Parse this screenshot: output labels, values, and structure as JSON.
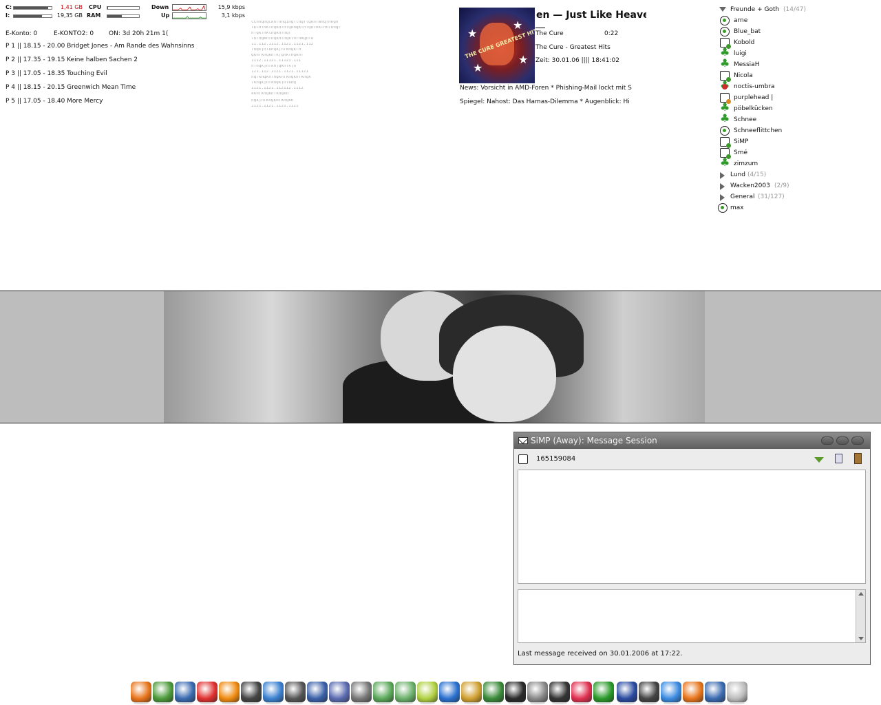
{
  "sysmon": {
    "drive_c_label": "C:",
    "drive_c_value": "1,41 GB",
    "drive_c_fill": 0.9,
    "drive_i_label": "I:",
    "drive_i_value": "19,35 GB",
    "drive_i_fill": 0.75,
    "cpu_label": "CPU",
    "cpu_fill": 0.02,
    "ram_label": "RAM",
    "ram_fill": 0.45,
    "down_label": "Down",
    "down_value": "15,9 kbps",
    "up_label": "Up",
    "up_value": "3,1 kbps",
    "down_color": "#cc2222",
    "up_color": "#2a9a2a"
  },
  "info": {
    "ekonto": "E-Konto:  0",
    "ekonto2": "E-KONTO2:  0",
    "online": "ON:  3d 20h 21m 1("
  },
  "tv": [
    {
      "text": "P 1 || 18.15 - 20.00  Bridget Jones - Am Rande des Wahnsinns"
    },
    {
      "text": "P 2 || 17.35 - 19.15  Keine halben Sachen 2"
    },
    {
      "text": "P 3 || 17.05 - 18.35  Touching Evil"
    },
    {
      "text": "P 4 || 18.15 - 20.15  Greenwich Mean Time"
    },
    {
      "text": "P 5 || 17.05 - 18.40  More Mercy"
    }
  ],
  "noise_lines": [
    "cchhghgckhfhhgihgflhgflgkhfmhgfhkgh",
    "lklhfhkfhgkhfhfgkhgkfhfgklhkfhhfkhgf",
    "hfgkfhklhgkhfhgf",
    "lhfhgkhfhgkhfhgklhfhkghfk",
    "11.112.1112.1121.1121.112",
    "fhgkjhfkhgkjhfkhgkfh",
    "gkhfkhgkhfkjghkfhgkhf",
    "1112.11121.11121.111",
    "hfhgkjhfkhjgkhfkjh",
    "121.112.1121.1121.11121",
    "hgfkhgkhfhgkhfkhgkhfkhgk",
    "fkhgkjhfkhgkjhfkhg",
    "1121.1121.112112.1112",
    "kkhfkhgkhfkhgkh",
    "hgkjhfkhgkhfkhgkh",
    "1121.1121.1121.1121"
  ],
  "now_playing": {
    "title": "en  —  Just Like Heaven",
    "artist": "The Cure",
    "time": "0:22",
    "album": "The Cure - Greatest Hits",
    "datetime": "Zeit: 30.01.06 |||| 18:41:02",
    "cover_text": "THE CURE  GREATEST HITS"
  },
  "news": {
    "line1": "News: Vorsicht in AMD-Foren * Phishing-Mail lockt mit S",
    "line2": "Spiegel: Nahost:  Das Hamas-Dilemma * Augenblick:  Hi"
  },
  "contacts": {
    "group_open": {
      "name": "Freunde + Goth",
      "count": "(14/47)"
    },
    "members": [
      {
        "name": "arne",
        "status": "online"
      },
      {
        "name": "Blue_bat",
        "status": "online"
      },
      {
        "name": "Kobold",
        "status": "mobile"
      },
      {
        "name": "luigi",
        "status": "clover"
      },
      {
        "name": "MessiaH",
        "status": "clover"
      },
      {
        "name": "Nicola",
        "status": "mobile"
      },
      {
        "name": "noctis-umbra",
        "status": "busy"
      },
      {
        "name": "purplehead |",
        "status": "away"
      },
      {
        "name": "pöbelkücken",
        "status": "clover"
      },
      {
        "name": "Schnee",
        "status": "clover"
      },
      {
        "name": "Schneeflittchen",
        "status": "online"
      },
      {
        "name": "SiMP",
        "status": "mobile"
      },
      {
        "name": "Smé",
        "status": "mobile"
      },
      {
        "name": "zimzum",
        "status": "clover"
      }
    ],
    "groups_closed": [
      {
        "name": "Lund",
        "count": "(4/15)"
      },
      {
        "name": "Wacken2003",
        "count": "(2/9)"
      },
      {
        "name": "General",
        "count": "(31/127)"
      }
    ],
    "self": {
      "name": "max",
      "status": "online"
    }
  },
  "message_window": {
    "title": "SiMP (Away): Message Session",
    "contact_number": "165159084",
    "status_line": "Last message received on 30.01.2006 at 17:22."
  },
  "dock": [
    {
      "name": "firefox-icon",
      "color": "#e8741a"
    },
    {
      "name": "messenger-icon",
      "color": "#4c9a3a"
    },
    {
      "name": "thunderbird-icon",
      "color": "#3a6ab0"
    },
    {
      "name": "lifebuoy-icon",
      "color": "#e03030"
    },
    {
      "name": "vlc-icon",
      "color": "#f08a10"
    },
    {
      "name": "fox-mask-icon",
      "color": "#444444"
    },
    {
      "name": "cube-icon",
      "color": "#3a80d0"
    },
    {
      "name": "eye-icon",
      "color": "#555555"
    },
    {
      "name": "network-icon",
      "color": "#3a60a8"
    },
    {
      "name": "s-disc-icon",
      "color": "#5a6ab0"
    },
    {
      "name": "satellite-icon",
      "color": "#777777"
    },
    {
      "name": "monitor-gear-icon",
      "color": "#5aa85a"
    },
    {
      "name": "monitor-settings-icon",
      "color": "#6ab06a"
    },
    {
      "name": "eye-ball-icon",
      "color": "#b0d040"
    },
    {
      "name": "plane-icon",
      "color": "#2a70d0"
    },
    {
      "name": "crown-icon",
      "color": "#d0a030"
    },
    {
      "name": "notepad-icon",
      "color": "#3a8a3a"
    },
    {
      "name": "activity-monitor-icon",
      "color": "#2a2a2a"
    },
    {
      "name": "computer-icon",
      "color": "#888888"
    },
    {
      "name": "unreal-icon",
      "color": "#333333"
    },
    {
      "name": "list-icon",
      "color": "#e03050"
    },
    {
      "name": "checkmark-icon",
      "color": "#2a9a2a"
    },
    {
      "name": "miranda-icon",
      "color": "#2a4aa0"
    },
    {
      "name": "fox-mask-2-icon",
      "color": "#444444"
    },
    {
      "name": "chat-bubble-icon",
      "color": "#3a8ae0"
    },
    {
      "name": "firefox-2-icon",
      "color": "#e8741a"
    },
    {
      "name": "thunderbird-2-icon",
      "color": "#3a6ab0"
    },
    {
      "name": "mail-icon",
      "color": "#bbbbbb"
    }
  ]
}
